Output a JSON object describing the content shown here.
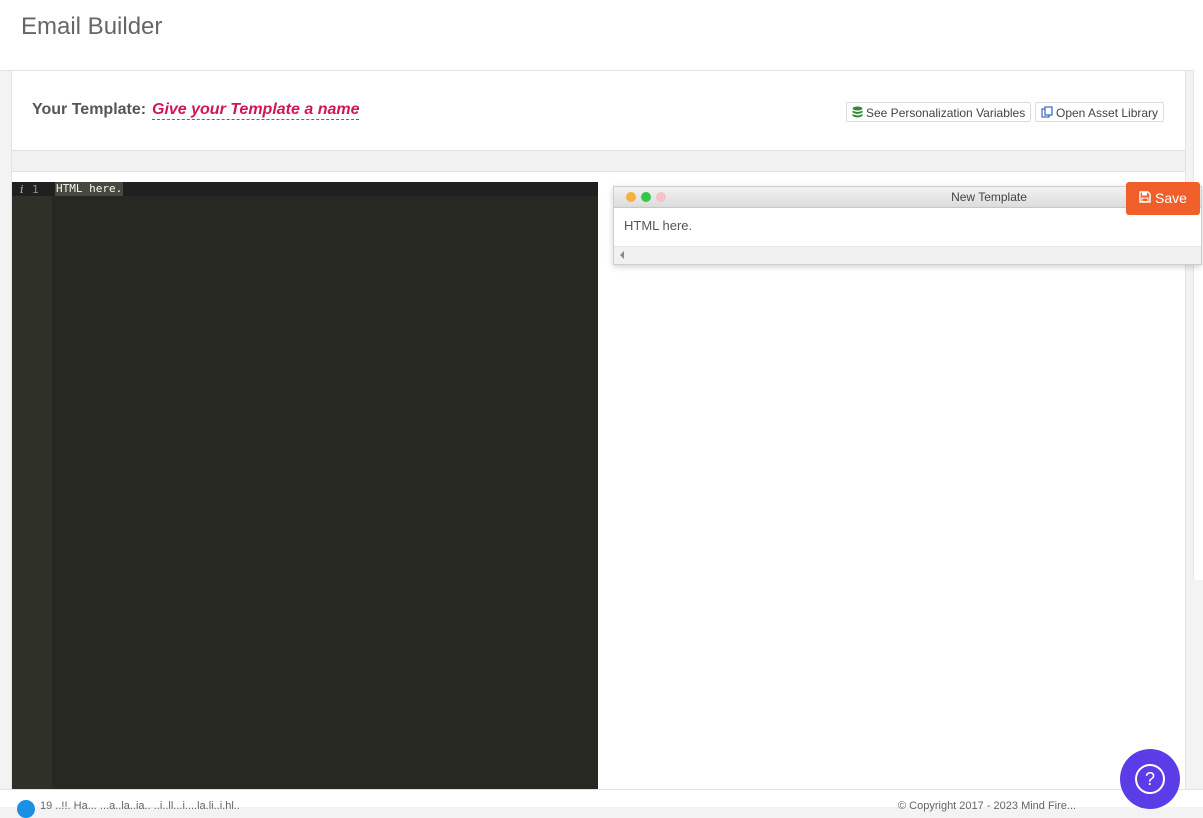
{
  "header": {
    "title": "Email Builder"
  },
  "template": {
    "label": "Your Template:",
    "name_placeholder": "Give your Template a name"
  },
  "actions": {
    "personalization_label": "See Personalization Variables",
    "asset_library_label": "Open Asset Library",
    "save_label": "Save"
  },
  "editor": {
    "gutter_info": "i",
    "line_numbers": [
      "1"
    ],
    "lines": [
      "HTML here."
    ]
  },
  "preview": {
    "window_title": "New Template",
    "body_text": "HTML here."
  },
  "footer": {
    "left_text": "19 ..!!. Ha... ...a..la..ia.. ..i..ll...i....la.li..i.hl..",
    "right_text": "© Copyright 2017 - 2023 Mind Fire..."
  },
  "help": {
    "symbol": "?"
  },
  "icons": {
    "personalization": "database-icon",
    "asset_library": "copy-icon",
    "save": "floppy-disk-icon",
    "help": "question-circle-icon"
  },
  "colors": {
    "accent_save": "#f05f2a",
    "template_name": "#d2145a",
    "help_button": "#5b3de8",
    "editor_bg": "#272822"
  }
}
